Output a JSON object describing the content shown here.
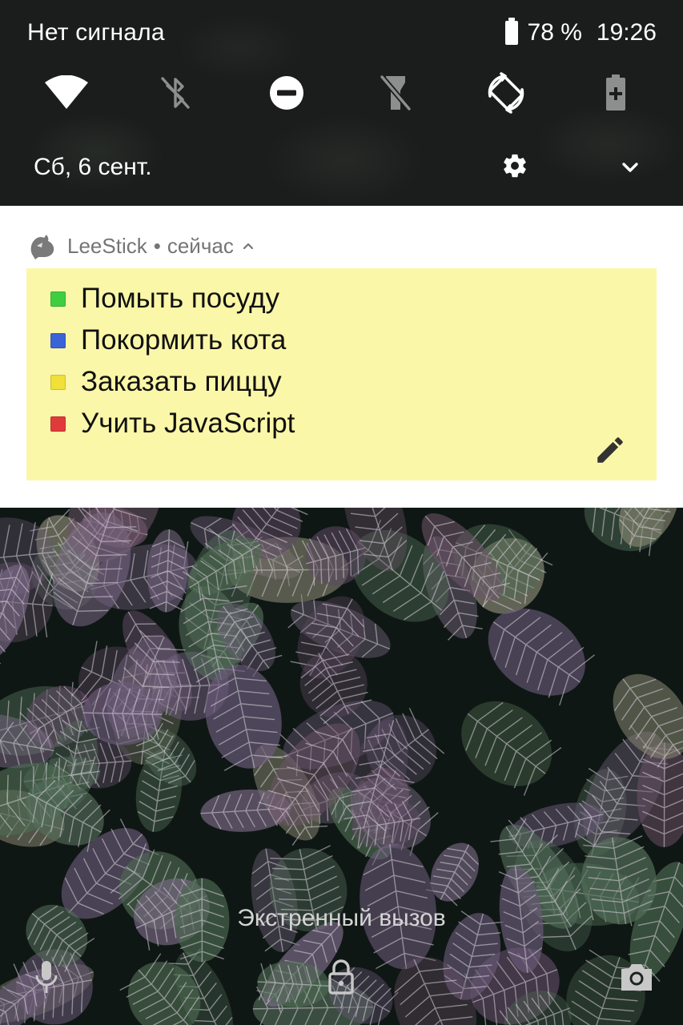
{
  "status_bar": {
    "carrier": "Нет сигнала",
    "battery": "78 %",
    "time": "19:26"
  },
  "quick_settings": {
    "tiles": [
      {
        "icon": "wifi-icon",
        "state": "on"
      },
      {
        "icon": "bluetooth-off-icon",
        "state": "off"
      },
      {
        "icon": "do-not-disturb-icon",
        "state": "on"
      },
      {
        "icon": "flashlight-off-icon",
        "state": "off"
      },
      {
        "icon": "auto-rotate-icon",
        "state": "on"
      },
      {
        "icon": "battery-saver-icon",
        "state": "off"
      }
    ],
    "date": "Сб, 6 сент.",
    "settings_icon": "gear-icon",
    "expand_icon": "chevron-down-icon"
  },
  "notification": {
    "app_name": "LeeStick",
    "separator": "•",
    "time": "сейчас",
    "sticky_color": "#fbf7a8",
    "items": [
      {
        "text": "Помыть посуду",
        "color": "#3fce3f"
      },
      {
        "text": "Покормить кота",
        "color": "#3a63d8"
      },
      {
        "text": "Заказать пиццу",
        "color": "#f1df3a"
      },
      {
        "text": "Учить JavaScript",
        "color": "#e03b3b"
      }
    ],
    "edit_icon": "pencil-icon"
  },
  "lockscreen": {
    "emergency_call": "Экстренный вызов",
    "left_icon": "microphone-icon",
    "center_icon": "lock-icon",
    "right_icon": "camera-icon"
  }
}
